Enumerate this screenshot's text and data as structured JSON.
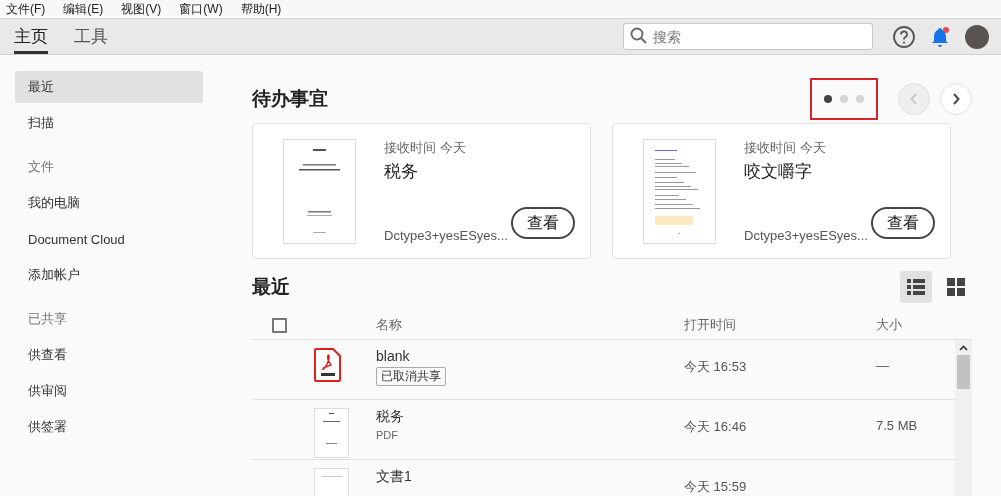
{
  "menu": [
    "文件(F)",
    "编辑(E)",
    "视图(V)",
    "窗口(W)",
    "帮助(H)"
  ],
  "tabs": [
    {
      "label": "主页",
      "selected": true
    },
    {
      "label": "工具",
      "selected": false
    }
  ],
  "search": {
    "placeholder": "搜索"
  },
  "sidebar": {
    "items": [
      {
        "kind": "item",
        "label": "最近",
        "selected": true
      },
      {
        "kind": "item",
        "label": "扫描",
        "selected": false
      },
      {
        "kind": "heading",
        "label": "文件"
      },
      {
        "kind": "item",
        "label": "我的电脑",
        "selected": false
      },
      {
        "kind": "item",
        "label": "Document Cloud",
        "selected": false
      },
      {
        "kind": "item",
        "label": "添加帐户",
        "selected": false
      },
      {
        "kind": "heading",
        "label": "已共享"
      },
      {
        "kind": "item",
        "label": "供查看",
        "selected": false
      },
      {
        "kind": "item",
        "label": "供审阅",
        "selected": false
      },
      {
        "kind": "item",
        "label": "供签署",
        "selected": false
      }
    ]
  },
  "todo": {
    "title": "待办事宜",
    "dots": [
      {
        "selected": true
      },
      {
        "selected": false
      },
      {
        "selected": false
      }
    ],
    "prev": {
      "disabled": true
    },
    "next": {
      "disabled": false
    },
    "cards": [
      {
        "kind": "cover",
        "received": "接收时间 今天",
        "name": "税务",
        "sender": "Dctype3+yesESyes...",
        "button": "查看"
      },
      {
        "kind": "letter",
        "received": "接收时间 今天",
        "name": "咬文嚼字",
        "sender": "Dctype3+yesESyes...",
        "button": "查看"
      }
    ]
  },
  "recent": {
    "title": "最近",
    "views": [
      {
        "kind": "list",
        "selected": true
      },
      {
        "kind": "grid",
        "selected": false
      }
    ],
    "select_all": {
      "checked": false
    },
    "columns": [
      "名称",
      "打开时间",
      "大小"
    ],
    "rows": [
      {
        "kind": "pdf",
        "name": "blank",
        "tag": "已取消共享",
        "time": "今天 16:53",
        "size": "—"
      },
      {
        "kind": "cover",
        "name": "税务",
        "type": "PDF",
        "time": "今天 16:46",
        "size": "7.5 MB"
      },
      {
        "kind": "blank",
        "name": "文書1",
        "time": "今天 15:59"
      }
    ]
  }
}
